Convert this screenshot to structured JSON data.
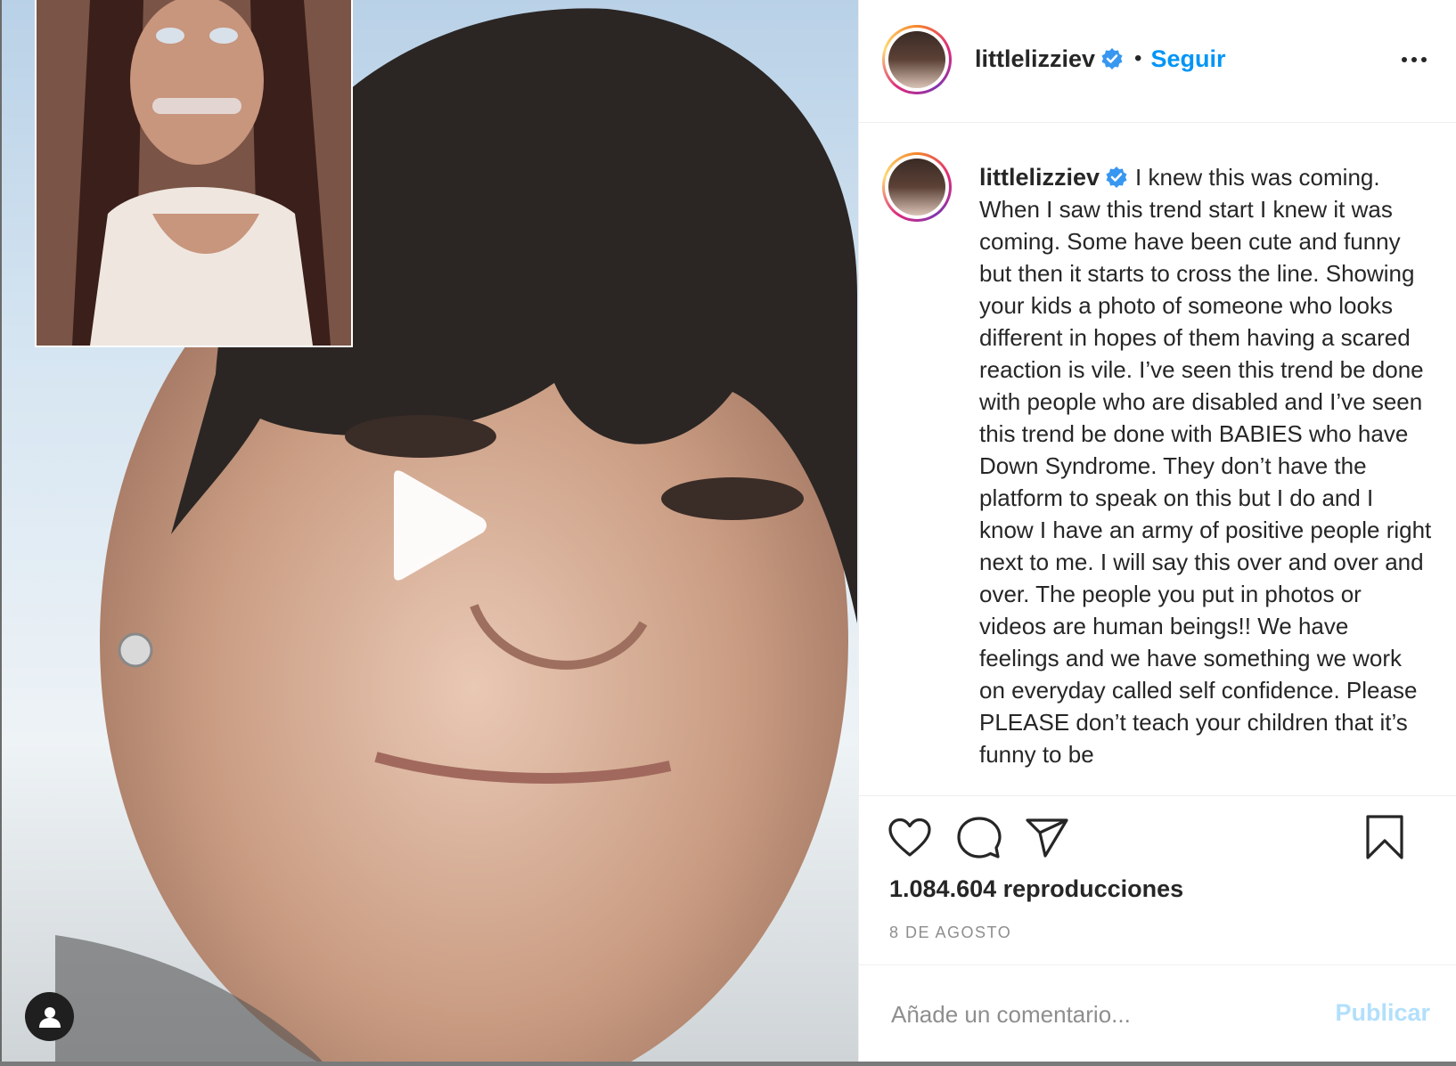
{
  "post": {
    "username": "littlelizziev",
    "follow_label": "Seguir",
    "separator": "•",
    "caption": "I knew this was coming. When I saw this trend start I knew it was coming. Some have been cute and funny but then it starts to cross the line. Showing your kids a photo of someone who looks different in hopes of them having a scared reaction is vile. I’ve seen this trend be done with people who are disabled and I’ve seen this trend be done with BABIES who have Down Syndrome. They don’t have the platform to speak on this but I do and I know I have an army of positive people right next to me. I will say this over and over and over. The people you put in photos or videos are human beings!! We have feelings and we have something we work on everyday called self confidence. Please PLEASE don’t teach your children that it’s funny to be",
    "views": "1.084.604 reproducciones",
    "date": "8 de agosto"
  },
  "comment": {
    "placeholder": "Añade un comentario...",
    "publish_label": "Publicar"
  },
  "icons": {
    "like": "heart-icon",
    "comment": "comment-icon",
    "share": "share-icon",
    "save": "bookmark-icon",
    "play": "play-icon",
    "verified": "verified-badge-icon",
    "more": "more-options-icon",
    "user_tag": "user-tag-icon"
  },
  "colors": {
    "link_blue": "#0095f6",
    "publish_disabled": "#b2dffc",
    "verified_blue": "#3897f0",
    "text": "#262626",
    "muted": "#8e8e8e"
  }
}
